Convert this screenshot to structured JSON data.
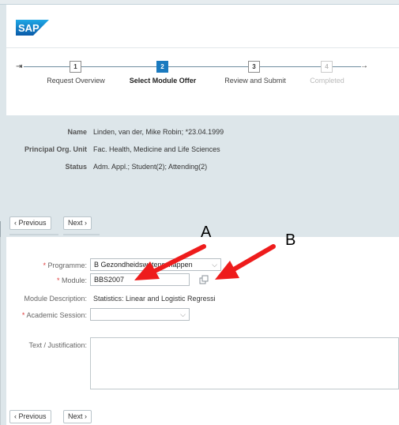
{
  "logo": {
    "text": "SAP"
  },
  "stepper": {
    "steps": [
      {
        "number": "1",
        "label": "Request Overview",
        "state": "visited"
      },
      {
        "number": "2",
        "label": "Select Module Offer",
        "state": "active"
      },
      {
        "number": "3",
        "label": "Review and Submit",
        "state": "upcoming"
      },
      {
        "number": "4",
        "label": "Completed",
        "state": "disabled"
      }
    ]
  },
  "student_info": {
    "name_label": "Name",
    "name_value": "Linden, van der, Mike Robin; *23.04.1999",
    "org_label": "Principal Org. Unit",
    "org_value": "Fac. Health, Medicine and Life Sciences",
    "status_label": "Status",
    "status_value": "Adm. Appl.; Student(2); Attending(2)"
  },
  "nav_top": {
    "previous": "Previous",
    "next": "Next"
  },
  "nav_bottom": {
    "previous": "Previous",
    "next": "Next"
  },
  "form": {
    "programme_label": "Programme:",
    "programme_value": "B Gezondheidswetenschappen",
    "module_label": "Module:",
    "module_value": "BBS2007",
    "module_desc_label": "Module Description:",
    "module_desc_value": "Statistics: Linear and Logistic Regressi",
    "session_label": "Academic Session:",
    "session_value": "",
    "text_label": "Text / Justification:",
    "text_value": "",
    "required_mark": "*"
  },
  "annotations": {
    "a": "A",
    "b": "B"
  },
  "colors": {
    "accent": "#1a7abf",
    "arrow": "#ee1c1c",
    "required": "#e03a3a"
  }
}
